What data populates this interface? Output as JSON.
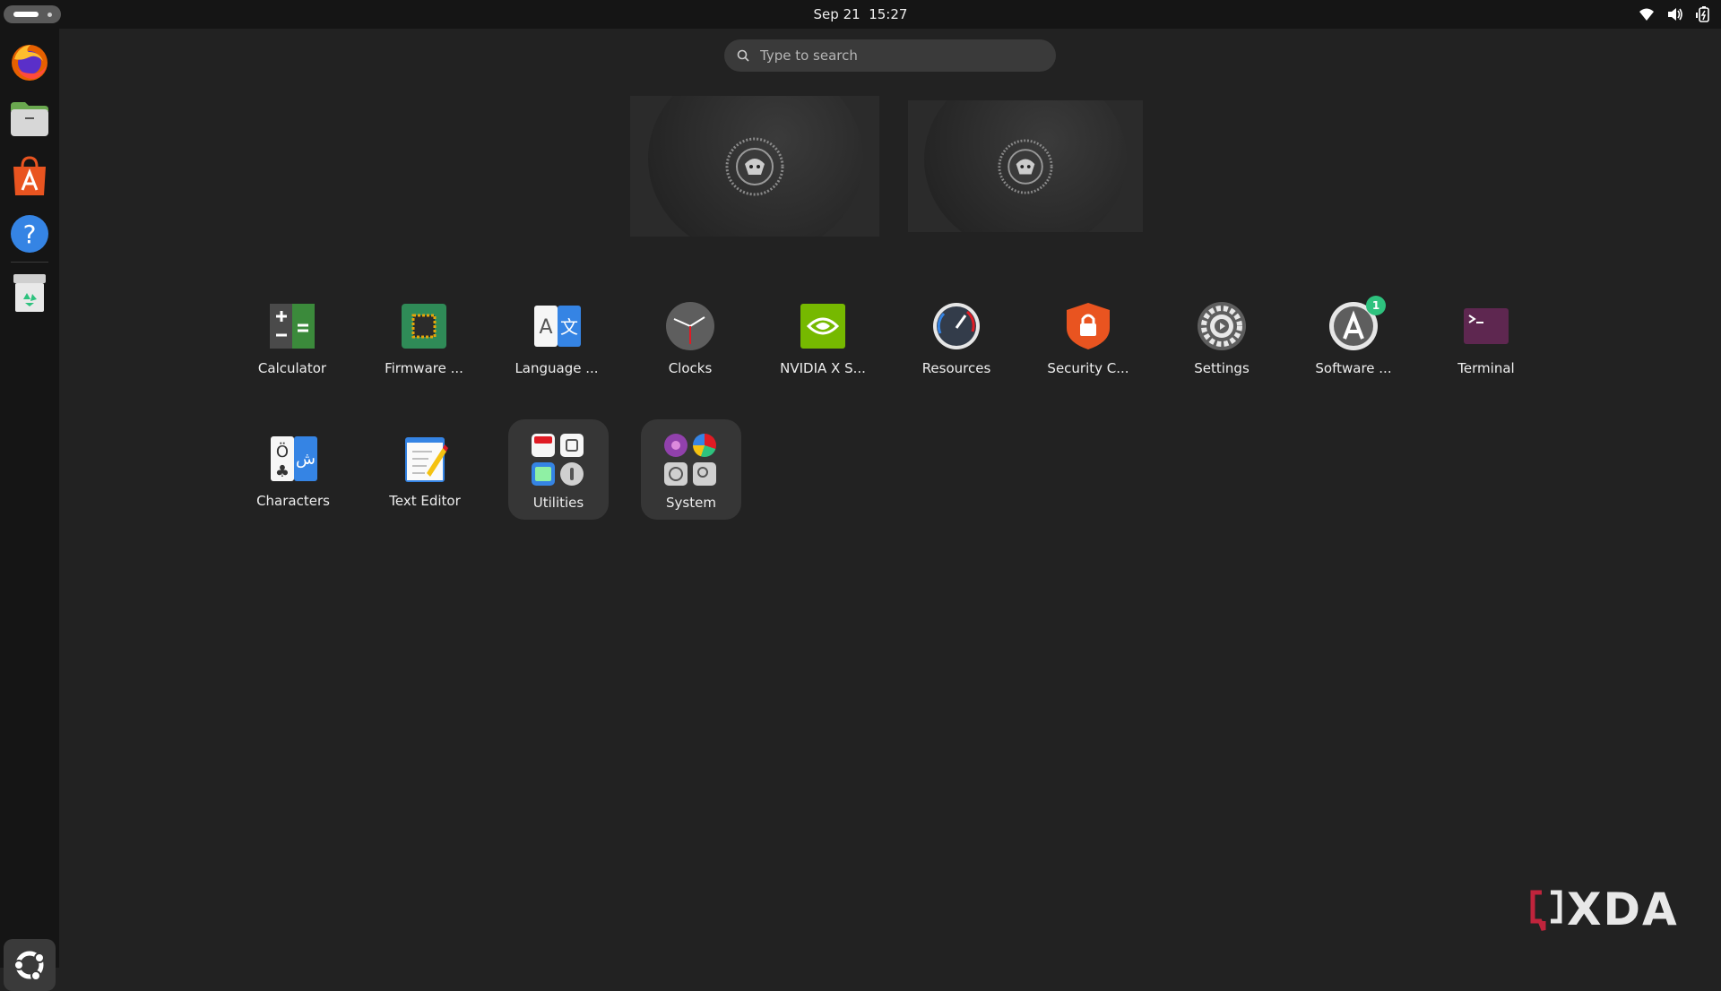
{
  "topbar": {
    "clock_date": "Sep 21",
    "clock_time": "15:27"
  },
  "search": {
    "placeholder": "Type to search"
  },
  "dock": {
    "items": [
      {
        "name": "firefox"
      },
      {
        "name": "files"
      },
      {
        "name": "app-center"
      },
      {
        "name": "help"
      },
      {
        "name": "trash"
      }
    ],
    "show_apps": "ubuntu-logo-icon"
  },
  "apps": {
    "row1": [
      {
        "label": "Calculator"
      },
      {
        "label": "Firmware ..."
      },
      {
        "label": "Language ..."
      },
      {
        "label": "Clocks"
      },
      {
        "label": "NVIDIA X S..."
      },
      {
        "label": "Resources"
      },
      {
        "label": "Security C..."
      },
      {
        "label": "Settings"
      },
      {
        "label": "Software ...",
        "badge": "1"
      },
      {
        "label": "Terminal"
      }
    ],
    "row2": [
      {
        "label": "Characters"
      },
      {
        "label": "Text Editor"
      },
      {
        "label": "Utilities"
      },
      {
        "label": "System"
      }
    ]
  },
  "watermark": {
    "text": "XDA"
  },
  "colors": {
    "background": "#222222",
    "topbar": "#151515",
    "accent_badge": "#2ec27e",
    "ubuntu_orange": "#e95420"
  }
}
